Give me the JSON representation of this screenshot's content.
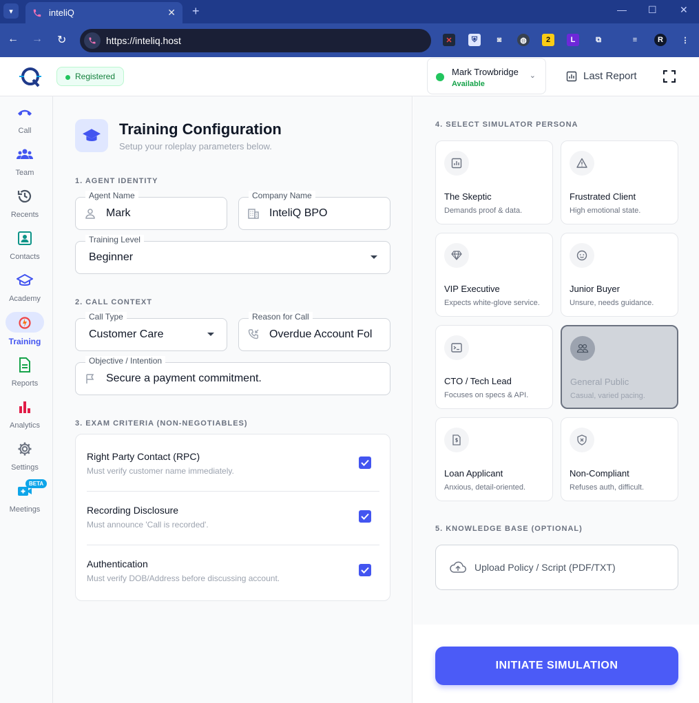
{
  "browser": {
    "tab_title": "inteliQ",
    "url": "https://inteliq.host"
  },
  "header": {
    "status_badge": "Registered",
    "user_name": "Mark Trowbridge",
    "user_status": "Available",
    "last_report_label": "Last Report"
  },
  "sidebar": {
    "items": [
      {
        "label": "Call",
        "icon": "phone-icon"
      },
      {
        "label": "Team",
        "icon": "team-icon"
      },
      {
        "label": "Recents",
        "icon": "history-icon"
      },
      {
        "label": "Contacts",
        "icon": "contacts-icon"
      },
      {
        "label": "Academy",
        "icon": "graduation-cap-icon"
      },
      {
        "label": "Training",
        "icon": "training-icon"
      },
      {
        "label": "Reports",
        "icon": "document-icon"
      },
      {
        "label": "Analytics",
        "icon": "bar-chart-icon"
      },
      {
        "label": "Settings",
        "icon": "gear-icon"
      },
      {
        "label": "Meetings",
        "icon": "video-plus-icon"
      }
    ],
    "active": "Training",
    "beta_badge": "BETA"
  },
  "config": {
    "title": "Training Configuration",
    "subtitle": "Setup your roleplay parameters below.",
    "section1": "1. AGENT IDENTITY",
    "agent_name_label": "Agent Name",
    "agent_name_value": "Mark",
    "company_name_label": "Company Name",
    "company_name_value": "InteliQ BPO",
    "training_level_label": "Training Level",
    "training_level_value": "Beginner",
    "section2": "2. CALL CONTEXT",
    "call_type_label": "Call Type",
    "call_type_value": "Customer Care",
    "reason_label": "Reason for Call",
    "reason_value": "Overdue Account Fol",
    "objective_label": "Objective / Intention",
    "objective_value": "Secure a payment commitment.",
    "section3": "3. EXAM CRITERIA (NON-NEGOTIABLES)",
    "criteria": [
      {
        "title": "Right Party Contact (RPC)",
        "desc": "Must verify customer name immediately.",
        "checked": true
      },
      {
        "title": "Recording Disclosure",
        "desc": "Must announce 'Call is recorded'.",
        "checked": true
      },
      {
        "title": "Authentication",
        "desc": "Must verify DOB/Address before discussing account.",
        "checked": true
      }
    ]
  },
  "persona": {
    "section4": "4. SELECT SIMULATOR PERSONA",
    "items": [
      {
        "title": "The Skeptic",
        "desc": "Demands proof & data.",
        "icon": "chart-icon"
      },
      {
        "title": "Frustrated Client",
        "desc": "High emotional state.",
        "icon": "warning-icon"
      },
      {
        "title": "VIP Executive",
        "desc": "Expects white-glove service.",
        "icon": "diamond-icon"
      },
      {
        "title": "Junior Buyer",
        "desc": "Unsure, needs guidance.",
        "icon": "face-icon"
      },
      {
        "title": "CTO / Tech Lead",
        "desc": "Focuses on specs & API.",
        "icon": "terminal-icon"
      },
      {
        "title": "General Public",
        "desc": "Casual, varied pacing.",
        "icon": "people-icon"
      },
      {
        "title": "Loan Applicant",
        "desc": "Anxious, detail-oriented.",
        "icon": "money-doc-icon"
      },
      {
        "title": "Non-Compliant",
        "desc": "Refuses auth, difficult.",
        "icon": "shield-x-icon"
      }
    ],
    "selected": "General Public",
    "section5": "5. KNOWLEDGE BASE (OPTIONAL)",
    "upload_label": "Upload Policy / Script (PDF/TXT)",
    "initiate_label": "INITIATE SIMULATION"
  },
  "colors": {
    "accent": "#4b5bf7",
    "brand_dark": "#1f3a8a",
    "status_green": "#22c55e"
  }
}
